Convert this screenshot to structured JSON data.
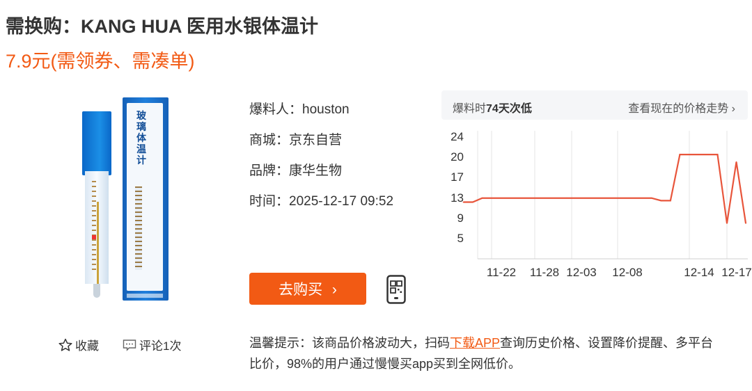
{
  "product": {
    "title": "需换购：KANG HUA 医用水银体温计",
    "price": "7.9元(需领券、需凑单)",
    "box_text": "玻璃体温计"
  },
  "info": {
    "poster": "爆料人：houston",
    "mall": "商城：京东自营",
    "brand": "品牌：康华生物",
    "time": "时间：2025-12-17 09:52"
  },
  "actions": {
    "buy_label": "去购买",
    "buy_arrow": "›",
    "favorite_label": "收藏",
    "comment_label": "评论1次"
  },
  "tip": {
    "before": "温馨提示：该商品价格波动大，扫码",
    "link": "下载APP",
    "after": "查询历史价格、设置降价提醒、多平台比价，98%的用户通过慢慢买app买到全网低价。"
  },
  "price_panel": {
    "left_prefix": "爆料时",
    "left_strong": "74天次低",
    "right": "查看现在的价格走势 ›"
  },
  "colors": {
    "accent": "#f25a14",
    "line": "#e8553b",
    "grid": "#e5e5e5"
  },
  "icons": {
    "favorite": "star-outline-icon",
    "comment": "comment-icon",
    "phone": "phone-qr-icon"
  },
  "chart_data": {
    "type": "line",
    "y_ticks": [
      24,
      20,
      17,
      13,
      9,
      5
    ],
    "x_ticks": [
      "11-22",
      "11-28",
      "12-03",
      "12-08",
      "12-14",
      "12-17"
    ],
    "grid": "vertical",
    "series": [
      {
        "values": [
          [
            "11-19",
            12.1
          ],
          [
            "11-20",
            12.1
          ],
          [
            "11-21",
            12.9
          ],
          [
            "11-30",
            12.9
          ],
          [
            "12-09",
            12.9
          ],
          [
            "12-10",
            12.4
          ],
          [
            "12-11",
            12.4
          ],
          [
            "12-12",
            20.4
          ],
          [
            "12-14",
            20.4
          ],
          [
            "12-16",
            20.4
          ],
          [
            "12-17",
            7.9
          ],
          [
            "12-18",
            19.2
          ],
          [
            "12-19",
            7.9
          ]
        ]
      }
    ]
  }
}
